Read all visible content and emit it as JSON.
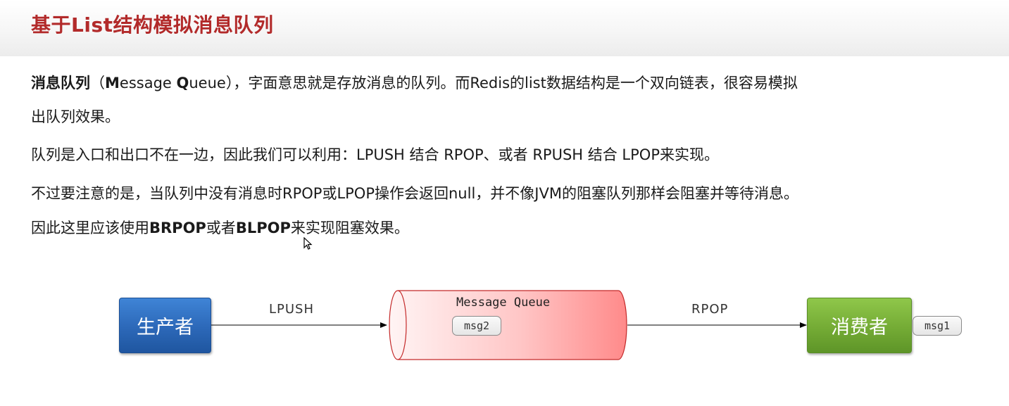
{
  "title": "基于List结构模拟消息队列",
  "paragraphs": {
    "p1": {
      "bold1": "消息队列",
      "open": "（",
      "m_bold": "M",
      "m_rest": "essage ",
      "q_bold": "Q",
      "q_rest": "ueue）",
      "line1_rest": "，字面意思就是存放消息的队列。而Redis的list数据结构是一个双向链表，很容易模拟",
      "line2": "出队列效果。"
    },
    "p2": "队列是入口和出口不在一边，因此我们可以利用：LPUSH 结合 RPOP、或者 RPUSH 结合 LPOP来实现。",
    "p3": "不过要注意的是，当队列中没有消息时RPOP或LPOP操作会返回null，并不像JVM的阻塞队列那样会阻塞并等待消息。",
    "p4": {
      "pre": "因此这里应该使用",
      "brpop": "BRPOP",
      "mid": "或者",
      "blpop": "BLPOP",
      "post": "来实现阻塞效果。"
    }
  },
  "diagram": {
    "producer": "生产者",
    "consumer": "消费者",
    "queue_label": "Message Queue",
    "lpush": "LPUSH",
    "rpop": "RPOP",
    "msg_in_queue": "msg2",
    "msg_consumed": "msg1"
  },
  "colors": {
    "title": "#b22a2a",
    "producer": "#2c68b8",
    "consumer": "#74ab35",
    "queue_fill_left": "#fff0f0",
    "queue_fill_right": "#ff8f8f"
  }
}
